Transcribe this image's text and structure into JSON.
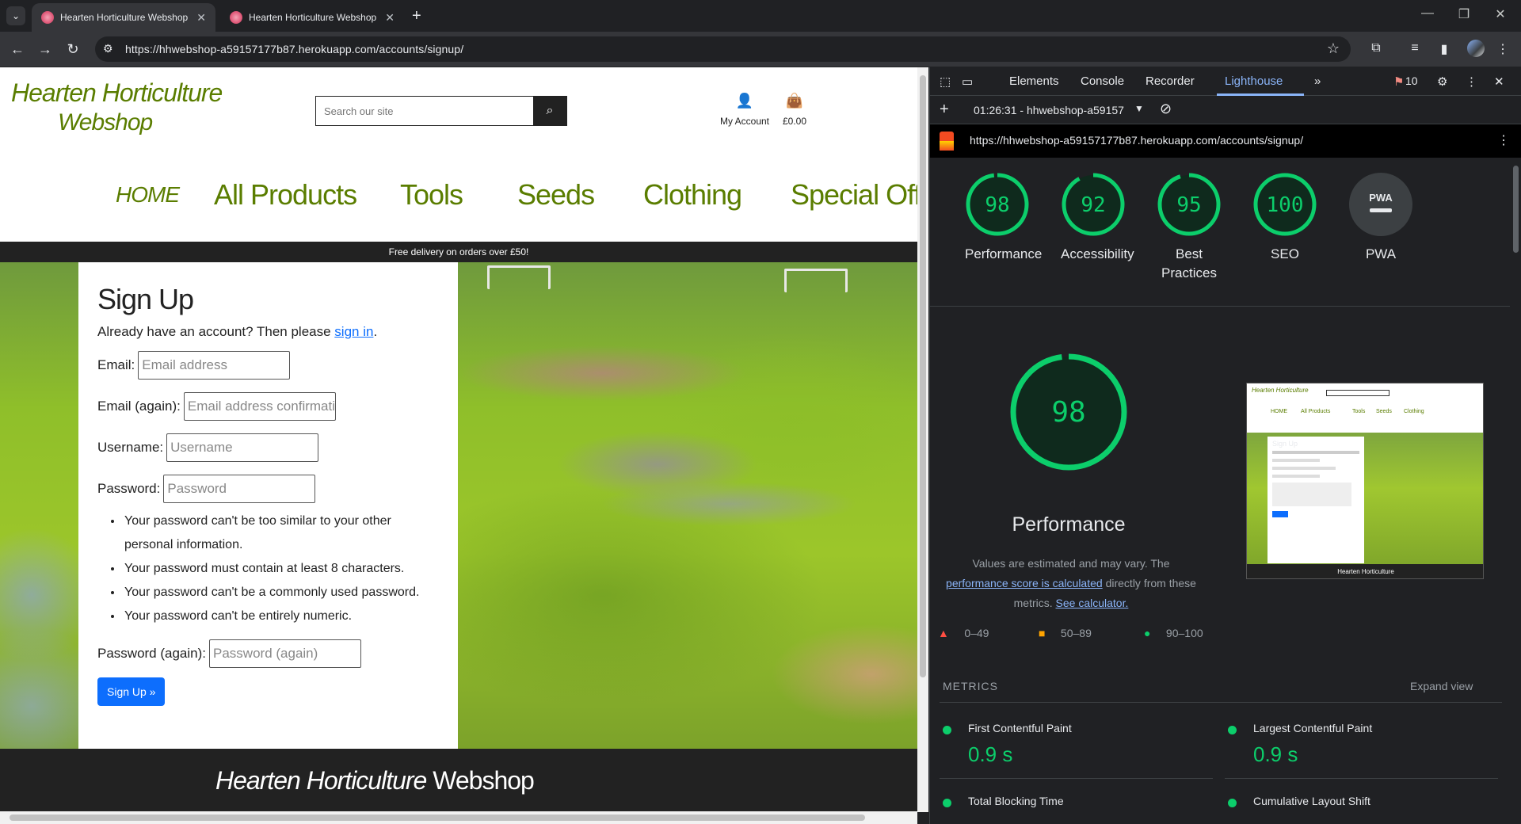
{
  "browser": {
    "tabs": [
      {
        "title": "Hearten Horticulture Webshop"
      },
      {
        "title": "Hearten Horticulture Webshop"
      }
    ],
    "url": "https://hhwebshop-a59157177b87.herokuapp.com/accounts/signup/"
  },
  "site": {
    "logo_line1": "Hearten Horticulture",
    "logo_line2": "Webshop",
    "search_placeholder": "Search our site",
    "account_label": "My Account",
    "basket_total": "£0.00",
    "nav": [
      "HOME",
      "All Products",
      "Tools",
      "Seeds",
      "Clothing",
      "Special Offe"
    ],
    "banner": "Free delivery on orders over £50!",
    "signup": {
      "title": "Sign Up",
      "lead_prefix": "Already have an account? Then please ",
      "lead_link": "sign in",
      "lead_suffix": ".",
      "email_label": "Email:",
      "email_placeholder": "Email address",
      "email2_label": "Email (again):",
      "email2_placeholder": "Email address confirmation",
      "username_label": "Username:",
      "username_placeholder": "Username",
      "password_label": "Password:",
      "password_placeholder": "Password",
      "rules": [
        "Your password can't be too similar to your other personal information.",
        "Your password must contain at least 8 characters.",
        "Your password can't be a commonly used password.",
        "Your password can't be entirely numeric."
      ],
      "password2_label": "Password (again):",
      "password2_placeholder": "Password (again)",
      "button": "Sign Up »"
    },
    "footer_brand": "Hearten Horticulture",
    "footer_brand2": "Webshop"
  },
  "devtools": {
    "tabs": [
      "Elements",
      "Console",
      "Recorder",
      "Lighthouse"
    ],
    "issues_count": "10",
    "report_label": "01:26:31 - hhwebshop-a59157",
    "report_url": "https://hhwebshop-a59157177b87.herokuapp.com/accounts/signup/",
    "scores": [
      {
        "label": "Performance",
        "value": 98
      },
      {
        "label": "Accessibility",
        "value": 92
      },
      {
        "label": "Best Practices",
        "value": 95
      },
      {
        "label": "SEO",
        "value": 100
      },
      {
        "label": "PWA",
        "value": null
      }
    ],
    "pwa_badge": "PWA",
    "perf_title": "Performance",
    "perf_score": "98",
    "desc_1": "Values are estimated and may vary. The",
    "desc_link1": "performance score is calculated",
    "desc_2": "directly from these metrics.",
    "desc_link2": "See calculator.",
    "legend": [
      "0–49",
      "50–89",
      "90–100"
    ],
    "metrics_heading": "METRICS",
    "expand": "Expand view",
    "metrics": [
      {
        "name": "First Contentful Paint",
        "value": "0.9 s"
      },
      {
        "name": "Largest Contentful Paint",
        "value": "0.9 s"
      },
      {
        "name": "Total Blocking Time",
        "value": ""
      },
      {
        "name": "Cumulative Layout Shift",
        "value": ""
      }
    ],
    "colors": {
      "pass": "#0cce6b",
      "average": "#ffa400",
      "fail": "#ff4e42",
      "accent": "#8ab4f8"
    }
  }
}
